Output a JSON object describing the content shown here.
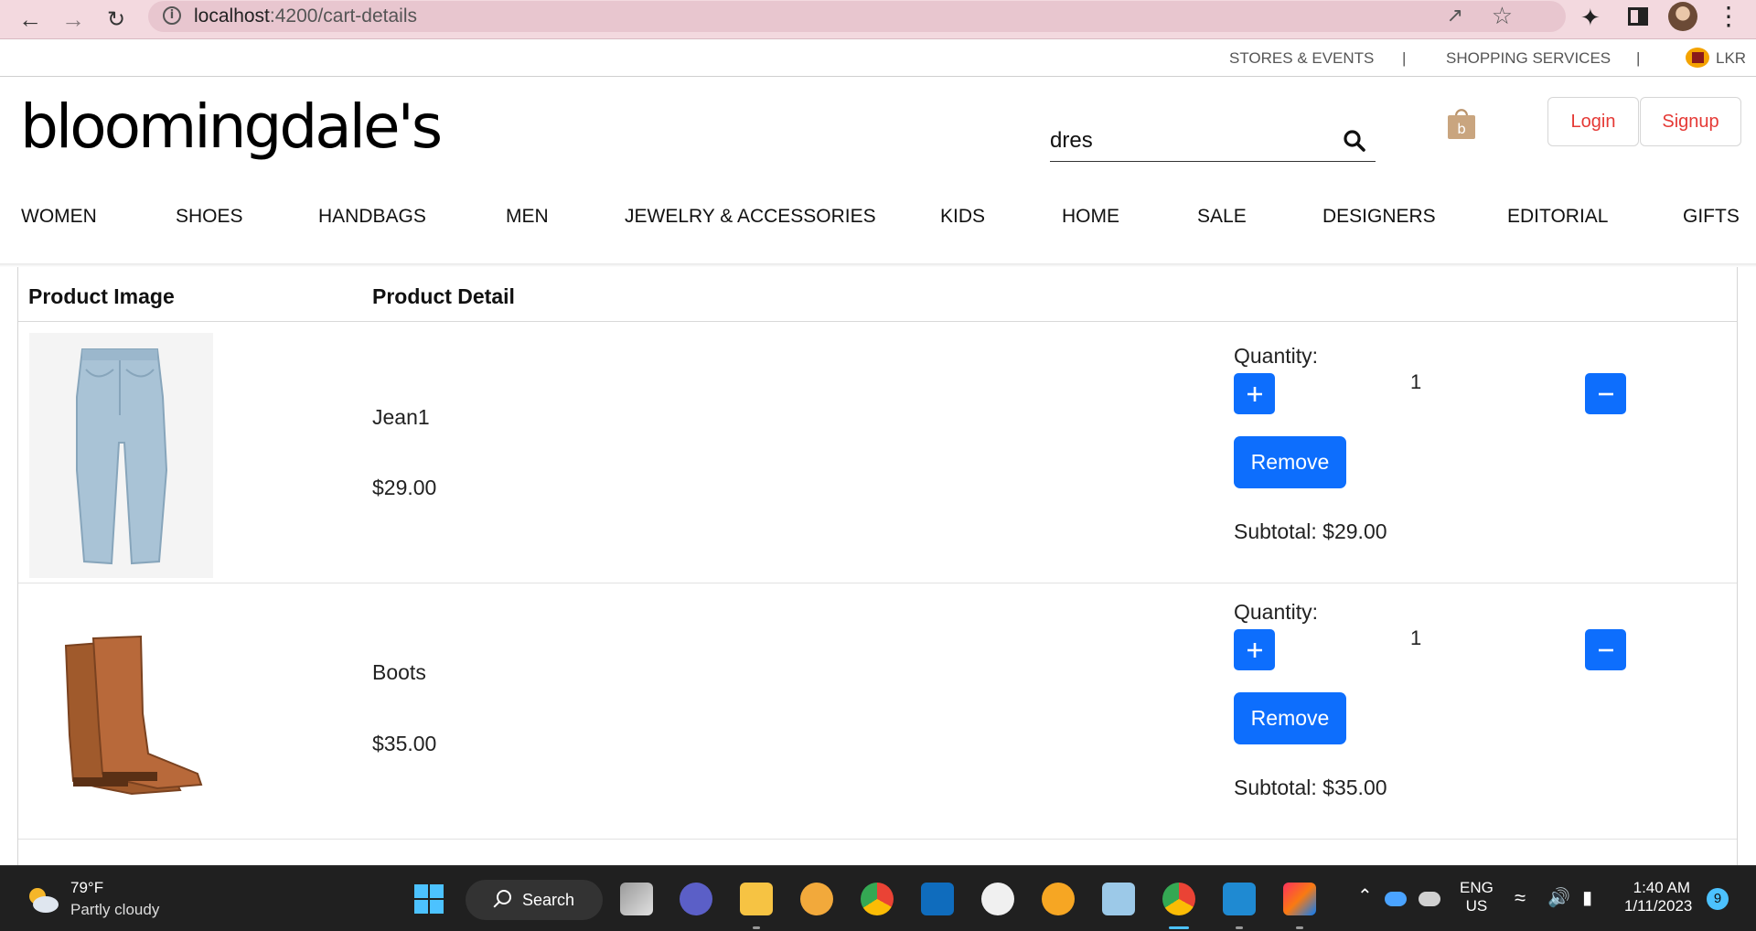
{
  "browser": {
    "url_host": "localhost",
    "url_rest": ":4200/cart-details"
  },
  "utility": {
    "stores": "STORES & EVENTS",
    "sep": "|",
    "shopping": "SHOPPING SERVICES",
    "currency": "LKR"
  },
  "header": {
    "logo": "bloomingdale's",
    "search_value": "dres",
    "login": "Login",
    "signup": "Signup"
  },
  "nav": [
    "WOMEN",
    "SHOES",
    "HANDBAGS",
    "MEN",
    "JEWELRY & ACCESSORIES",
    "KIDS",
    "HOME",
    "SALE",
    "DESIGNERS",
    "EDITORIAL",
    "GIFTS"
  ],
  "cart": {
    "col_image": "Product Image",
    "col_detail": "Product Detail",
    "items": [
      {
        "name": "Jean1",
        "price": "$29.00",
        "quantity_label": "Quantity:",
        "quantity": "1",
        "remove": "Remove",
        "subtotal": "Subtotal: $29.00"
      },
      {
        "name": "Boots",
        "price": "$35.00",
        "quantity_label": "Quantity:",
        "quantity": "1",
        "remove": "Remove",
        "subtotal": "Subtotal: $35.00"
      }
    ]
  },
  "taskbar": {
    "temp": "79°F",
    "weather": "Partly cloudy",
    "search": "Search",
    "lang1": "ENG",
    "lang2": "US",
    "time": "1:40 AM",
    "date": "1/11/2023",
    "notifications": "9"
  },
  "colors": {
    "primary": "#0d6efd",
    "auth_text": "#e53935",
    "chrome_bg": "#f3d9df",
    "taskbar_bg": "#202020"
  }
}
